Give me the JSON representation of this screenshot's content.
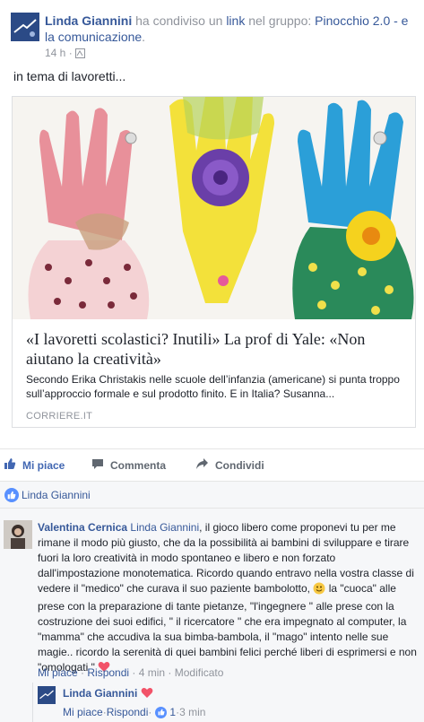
{
  "post": {
    "author": "Linda Giannini",
    "action_text": " ha condiviso un ",
    "link_word": "link",
    "group_prefix": " nel gruppo: ",
    "group_name": "Pinocchio 2.0 - e la comunicazione",
    "group_suffix": ".",
    "time": "14 h",
    "separator": " · ",
    "text": "in tema di lavoretti..."
  },
  "link_card": {
    "title": "«I lavoretti scolastici? Inutili» La prof di Yale: «Non aiutano la creatività»",
    "description": "Secondo Erika Christakis nelle scuole dell’infanzia (americane) si punta troppo sull’approccio formale e sul prodotto finito. E in Italia? Susanna...",
    "domain": "CORRIERE.IT"
  },
  "actions": {
    "like": "Mi piace",
    "comment": "Commenta",
    "share": "Condividi"
  },
  "likes": {
    "names": "Linda Giannini"
  },
  "comments": [
    {
      "author": "Valentina Cernica",
      "mention": "Linda Giannini",
      "text_1": ", il gioco libero come proponevi tu per me rimane il modo più giusto, che da la possibilità ai bambini di sviluppare e tirare fuori la loro creatività in modo spontaneo e libero e non forzato dall'impostazione monotematica. Ricordo quando entravo nella vostra classe di vedere il \"medico\" che curava il suo paziente bambolotto, ",
      "text_2": " la \"cuoca\" alle prese con la preparazione di tante pietanze, \"l'ingegnere \" alle prese con la costruzione dei suoi edifici, \" il ricercatore \" che era impegnato al computer, la \"mamma\" che accudiva la sua bimba-bambola, il \"mago\" intento nelle sue magie.. ricordo la serenità di quei bambini felici perché liberi di esprimersi e non \"omologati \" ",
      "like": "Mi piace",
      "reply": "Rispondi",
      "time": "4 min",
      "edited": "Modificato",
      "sep": " · "
    },
    {
      "author": "Linda Giannini",
      "like": "Mi piace",
      "reply": "Rispondi",
      "like_count": "1",
      "time": "3 min",
      "sep": " · "
    }
  ],
  "colors": {
    "link_blue": "#365899",
    "like_blue": "#4267b2",
    "heart": "#f25268",
    "meta_grey": "#90949c"
  },
  "icons": {
    "globe": "globe-icon",
    "like": "thumbs-up-icon",
    "comment": "comment-icon",
    "share": "share-arrow-icon",
    "heart": "heart-icon",
    "smiley": "smiley-icon"
  }
}
